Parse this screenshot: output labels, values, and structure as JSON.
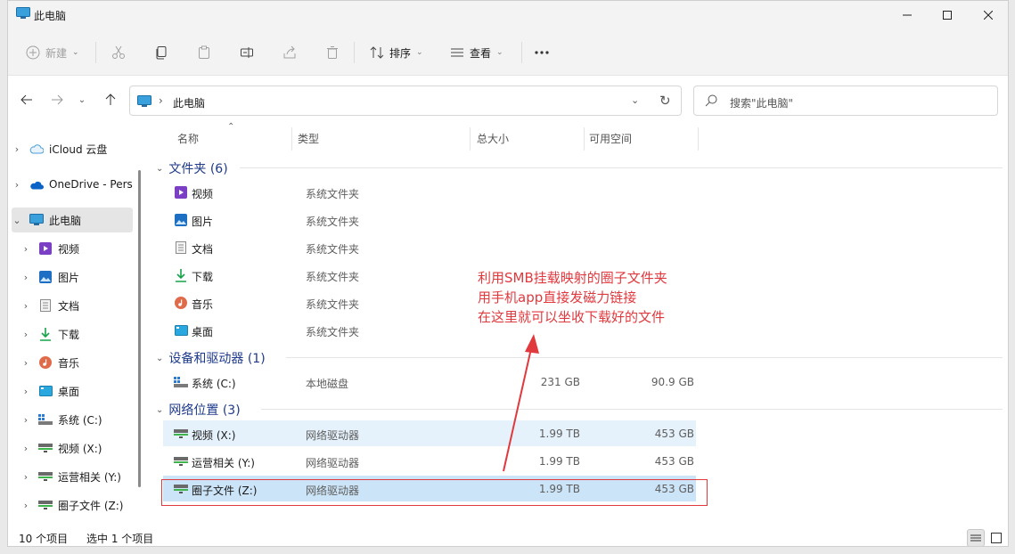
{
  "window": {
    "title": "此电脑"
  },
  "toolbar": {
    "new_label": "新建",
    "sort_label": "排序",
    "view_label": "查看"
  },
  "address": {
    "path": "此电脑",
    "search_placeholder": "搜索\"此电脑\""
  },
  "sidebar": {
    "items": [
      {
        "label": "iCloud 云盘",
        "icon": "icloud-icon"
      },
      {
        "label": "OneDrive - Pers",
        "icon": "onedrive-icon"
      },
      {
        "label": "此电脑",
        "icon": "computer-icon"
      },
      {
        "label": "视频",
        "icon": "video-folder-icon"
      },
      {
        "label": "图片",
        "icon": "pictures-folder-icon"
      },
      {
        "label": "文档",
        "icon": "documents-folder-icon"
      },
      {
        "label": "下载",
        "icon": "downloads-folder-icon"
      },
      {
        "label": "音乐",
        "icon": "music-folder-icon"
      },
      {
        "label": "桌面",
        "icon": "desktop-folder-icon"
      },
      {
        "label": "系统 (C:)",
        "icon": "local-drive-icon"
      },
      {
        "label": "视频 (X:)",
        "icon": "network-drive-icon"
      },
      {
        "label": "运营相关 (Y:)",
        "icon": "network-drive-icon"
      },
      {
        "label": "圈子文件 (Z:)",
        "icon": "network-drive-icon"
      }
    ]
  },
  "columns": {
    "name": "名称",
    "type": "类型",
    "total": "总大小",
    "free": "可用空间"
  },
  "groups": {
    "folders": "文件夹 (6)",
    "drives": "设备和驱动器 (1)",
    "network": "网络位置 (3)"
  },
  "folders": [
    {
      "name": "视频",
      "type": "系统文件夹",
      "icon": "video-folder-icon"
    },
    {
      "name": "图片",
      "type": "系统文件夹",
      "icon": "pictures-folder-icon"
    },
    {
      "name": "文档",
      "type": "系统文件夹",
      "icon": "documents-folder-icon"
    },
    {
      "name": "下载",
      "type": "系统文件夹",
      "icon": "downloads-folder-icon"
    },
    {
      "name": "音乐",
      "type": "系统文件夹",
      "icon": "music-folder-icon"
    },
    {
      "name": "桌面",
      "type": "系统文件夹",
      "icon": "desktop-folder-icon"
    }
  ],
  "drives": [
    {
      "name": "系统 (C:)",
      "type": "本地磁盘",
      "total": "231 GB",
      "free": "90.9 GB"
    }
  ],
  "network": [
    {
      "name": "视频 (X:)",
      "type": "网络驱动器",
      "total": "1.99 TB",
      "free": "453 GB"
    },
    {
      "name": "运营相关 (Y:)",
      "type": "网络驱动器",
      "total": "1.99 TB",
      "free": "453 GB"
    },
    {
      "name": "圈子文件 (Z:)",
      "type": "网络驱动器",
      "total": "1.99 TB",
      "free": "453 GB"
    }
  ],
  "annotation": {
    "line1": "利用SMB挂载映射的圈子文件夹",
    "line2": "用手机app直接发磁力链接",
    "line3": "在这里就可以坐收下载好的文件",
    "color": "#e0393e"
  },
  "status": {
    "count": "10 个项目",
    "selected": "选中 1 个项目"
  }
}
